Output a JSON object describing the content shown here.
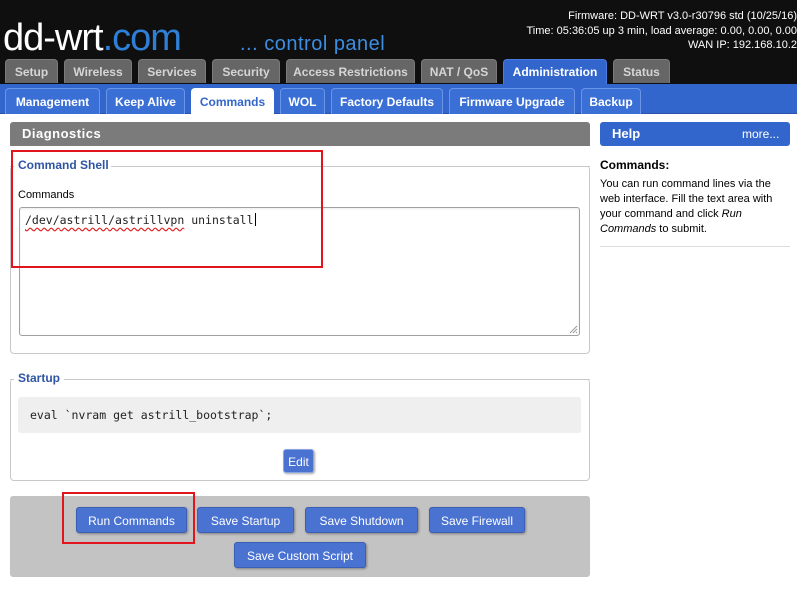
{
  "header": {
    "logo_part1": "dd-wrt",
    "logo_part2": ".com",
    "subtitle": "... control panel",
    "firmware": "Firmware: DD-WRT v3.0-r30796 std (10/25/16)",
    "time": "Time: 05:36:05 up 3 min, load average: 0.00, 0.00, 0.00",
    "wan_ip": "WAN IP: 192.168.10.2"
  },
  "top_tabs": [
    {
      "label": "Setup"
    },
    {
      "label": "Wireless"
    },
    {
      "label": "Services"
    },
    {
      "label": "Security"
    },
    {
      "label": "Access Restrictions"
    },
    {
      "label": "NAT / QoS"
    },
    {
      "label": "Administration"
    },
    {
      "label": "Status"
    }
  ],
  "sub_tabs": [
    {
      "label": "Management"
    },
    {
      "label": "Keep Alive"
    },
    {
      "label": "Commands"
    },
    {
      "label": "WOL"
    },
    {
      "label": "Factory Defaults"
    },
    {
      "label": "Firmware Upgrade"
    },
    {
      "label": "Backup"
    }
  ],
  "main": {
    "title": "Diagnostics",
    "command_shell": {
      "legend": "Command Shell",
      "label": "Commands",
      "value_parts": [
        "/dev/",
        "astrill",
        "/",
        "astrillvpn",
        " uninstall"
      ]
    },
    "startup": {
      "legend": "Startup",
      "script": "eval `nvram get astrill_bootstrap`;",
      "edit_label": "Edit"
    },
    "buttons": {
      "run_commands": "Run Commands",
      "save_startup": "Save Startup",
      "save_shutdown": "Save Shutdown",
      "save_firewall": "Save Firewall",
      "save_custom_script": "Save Custom Script"
    }
  },
  "help": {
    "title": "Help",
    "more": "more...",
    "heading": "Commands:",
    "body_before": "You can run command lines via the web interface. Fill the text area with your command and click ",
    "body_em": "Run Commands",
    "body_after": " to submit."
  },
  "colors": {
    "accent": "#3366cc",
    "header_bg": "#0f0f0f",
    "highlight_box": "#e2141c"
  }
}
